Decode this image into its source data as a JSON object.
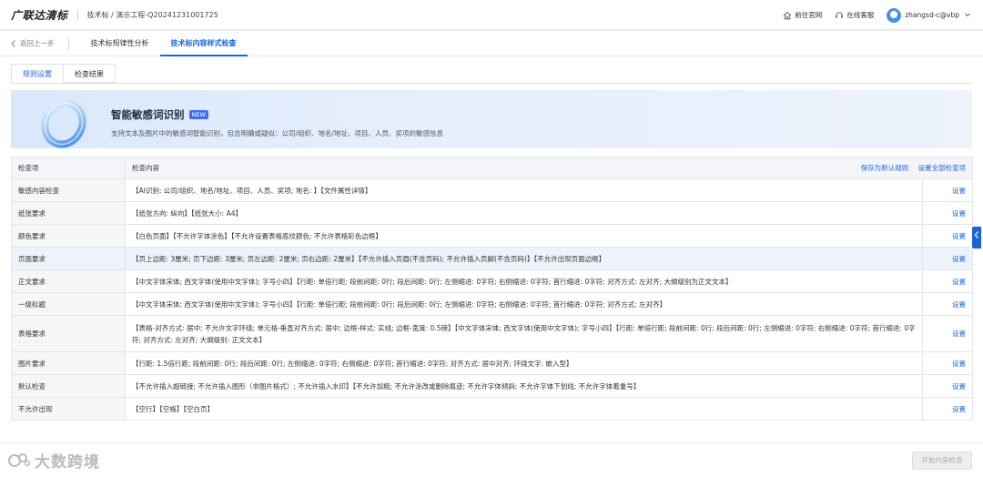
{
  "header": {
    "logo": "广联达清标",
    "breadcrumb": "技术标 / 演示工程-Q20241231001725",
    "links": [
      {
        "label": "前往官网",
        "icon": "home-icon"
      },
      {
        "label": "在线客服",
        "icon": "headset-icon"
      }
    ],
    "user": "zhangsd-c@vbp",
    "user_icon": "chevron-down-icon"
  },
  "nav": {
    "back_label": "返回上一步",
    "tabs": [
      {
        "label": "技术标规律性分析",
        "active": false
      },
      {
        "label": "技术标内容样式检查",
        "active": true
      }
    ]
  },
  "subtabs": [
    {
      "label": "规则设置",
      "active": true
    },
    {
      "label": "检查结果",
      "active": false
    }
  ],
  "banner": {
    "title": "智能敏感词识别",
    "badge": "NEW",
    "desc": "支持文本及图片中的敏感词智能识别，包含明确或疑似：公司/组织、地名/地址、项目、人员、奖项的敏感信息"
  },
  "table": {
    "col_item": "检查项",
    "col_content": "检查内容",
    "save_default": "保存为默认规则",
    "set_all": "设置全部检查项",
    "action_label": "设置",
    "rows": [
      {
        "item": "敏感内容检查",
        "content": "【AI识别: 公司/组织、地名/地址、项目、人员、奖项; 地名: 】【文件属性详情】"
      },
      {
        "item": "纸张要求",
        "content": "【纸张方向: 纵向】【纸张大小: A4】"
      },
      {
        "item": "颜色要求",
        "content": "【白色页面】【不允许字体涂色】【不允许设置表格底纹颜色; 不允许表格彩色边框】"
      },
      {
        "item": "页面要求",
        "content": "【页上边距: 3厘米; 页下边距: 3厘米; 页左边距: 2厘米; 页右边距: 2厘米】【不允许插入页眉(不含页码); 不允许插入页脚(不含页码)】【不允许出现页面边框】"
      },
      {
        "item": "正文要求",
        "content": "【中文字体宋体; 西文字体(使用中文字体); 字号小四】【行距: 单倍行距; 段前间距: 0行; 段后间距: 0行; 左侧缩进: 0字符; 右侧缩进: 0字符; 首行缩进: 0字符; 对齐方式: 左对齐; 大纲级别为正文文本】"
      },
      {
        "item": "一级标题",
        "content": "【中文字体宋体; 西文字体(使用中文字体); 字号小四】【行距: 单倍行距; 段前间距: 0行; 段后间距: 0行; 左侧缩进: 0字符; 右侧缩进: 0字符; 首行缩进: 0字符; 对齐方式: 左对齐】"
      },
      {
        "item": "表格要求",
        "content": "【表格-对齐方式: 居中; 不允许文字环绕; 单元格-垂直对齐方式: 居中; 边框-样式: 实线; 边框-宽度: 0.5磅】【中文字体宋体; 西文字体(使用中文字体); 字号小四】【行距: 单倍行距; 段前间距: 0行; 段后间距: 0行; 左侧缩进: 0字符; 右侧缩进: 0字符; 首行缩进: 0字符; 对齐方式: 左对齐; 大纲级别: 正文文本】"
      },
      {
        "item": "图片要求",
        "content": "【行距: 1.5倍行距; 段前间距: 0行; 段后间距: 0行; 左侧缩进: 0字符; 右侧缩进: 0字符; 首行缩进: 0字符; 对齐方式: 居中对齐; 环绕文字: 嵌入型】"
      },
      {
        "item": "默认检查",
        "content": "【不允许插入超链接; 不允许插入图形（非图片格式）; 不允许插入水印】【不允许加粗; 不允许涂改或删除痕迹; 不允许字体倾斜; 不允许字体下划线; 不允许字体着重号】"
      },
      {
        "item": "不允许出现",
        "content": "【空行】【空格】【空白页】"
      }
    ]
  },
  "footer": {
    "start_button": "开始内容检查",
    "watermark": "大数跨境"
  },
  "colors": {
    "accent": "#1a66d9",
    "badge": "#3f6ff0"
  }
}
